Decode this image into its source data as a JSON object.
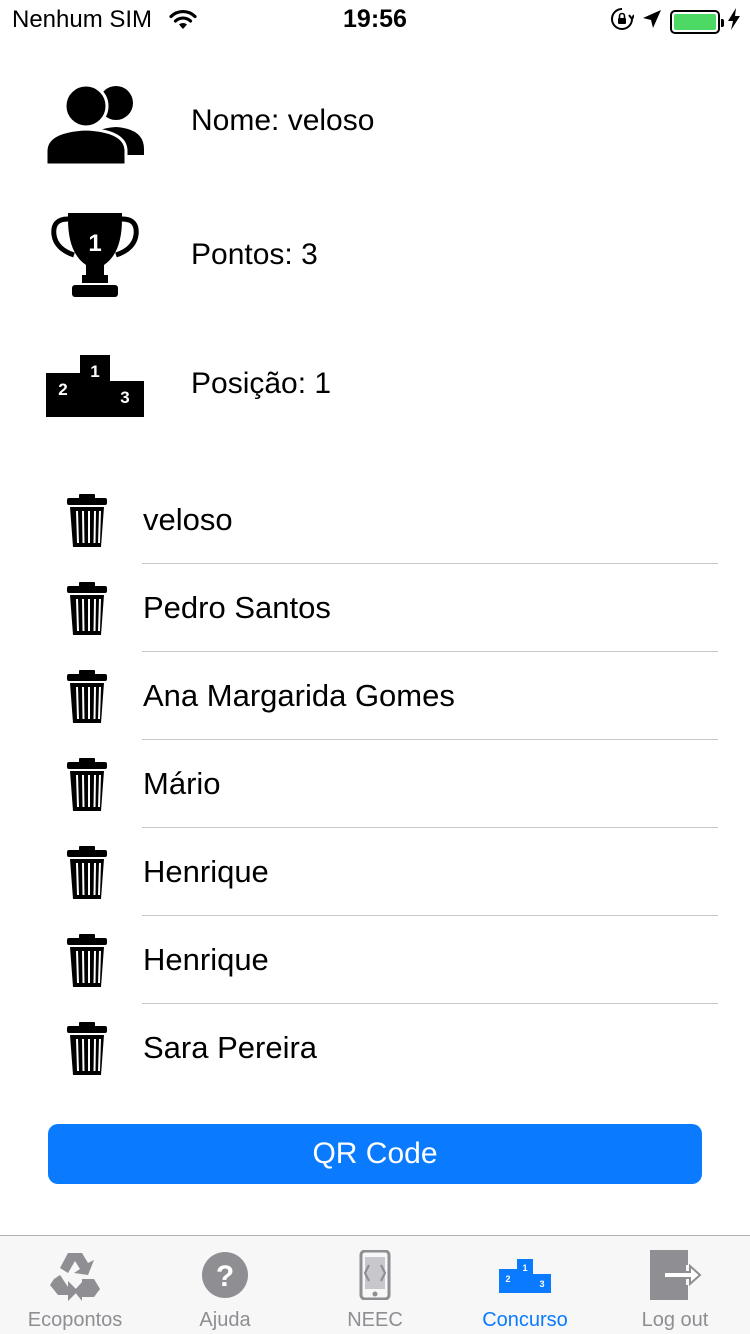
{
  "status_bar": {
    "carrier": "Nenhum SIM",
    "time": "19:56",
    "battery_level": 1.0
  },
  "profile": {
    "name_text": "Nome: veloso",
    "points_text": "Pontos: 3",
    "position_text": "Posição: 1",
    "icons": [
      "users-icon",
      "trophy-icon",
      "podium-icon"
    ]
  },
  "users": [
    {
      "name": "veloso"
    },
    {
      "name": "Pedro Santos"
    },
    {
      "name": "Ana Margarida Gomes"
    },
    {
      "name": "Mário"
    },
    {
      "name": "Henrique"
    },
    {
      "name": "Henrique"
    },
    {
      "name": "Sara Pereira"
    }
  ],
  "qr_button": {
    "label": "QR Code"
  },
  "tabs": [
    {
      "label": "Ecopontos",
      "icon": "recycle-icon",
      "active": false
    },
    {
      "label": "Ajuda",
      "icon": "help-icon",
      "active": false
    },
    {
      "label": "NEEC",
      "icon": "phone-icon",
      "active": false
    },
    {
      "label": "Concurso",
      "icon": "podium-icon",
      "active": true
    },
    {
      "label": "Log out",
      "icon": "logout-icon",
      "active": false
    }
  ],
  "colors": {
    "accent": "#0a7bff",
    "battery": "#4cd964",
    "inactive_tab": "#8e8e93",
    "separator": "#c8c7cc"
  }
}
